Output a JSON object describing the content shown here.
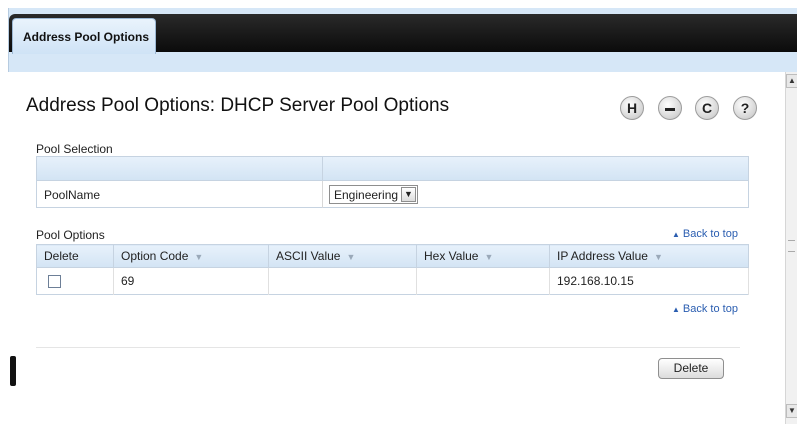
{
  "tabs": [
    {
      "label": "Address Pool Options",
      "active": true
    }
  ],
  "page": {
    "title": "Address Pool Options: DHCP Server Pool Options"
  },
  "toolbar": {
    "save_icon": "save-icon",
    "print_icon": "print-icon",
    "refresh_icon": "refresh-icon",
    "help_icon": "help-icon",
    "save_glyph": "H",
    "print_glyph": "▬",
    "refresh_glyph": "C",
    "help_glyph": "?"
  },
  "pool_selection": {
    "label": "Pool Selection",
    "field_label": "PoolName",
    "selected": "Engineering"
  },
  "pool_options": {
    "label": "Pool Options",
    "back_to_top": "Back to top",
    "columns": [
      "Delete",
      "Option Code",
      "ASCII Value",
      "Hex Value",
      "IP Address Value"
    ],
    "rows": [
      {
        "delete": false,
        "option_code": "69",
        "ascii_value": "",
        "hex_value": "",
        "ip_address_value": "192.168.10.15"
      }
    ]
  },
  "actions": {
    "delete_label": "Delete"
  },
  "colors": {
    "accent": "#2a5db0",
    "header_bg": "#d6e7f7",
    "tab_strip": "#111111"
  }
}
